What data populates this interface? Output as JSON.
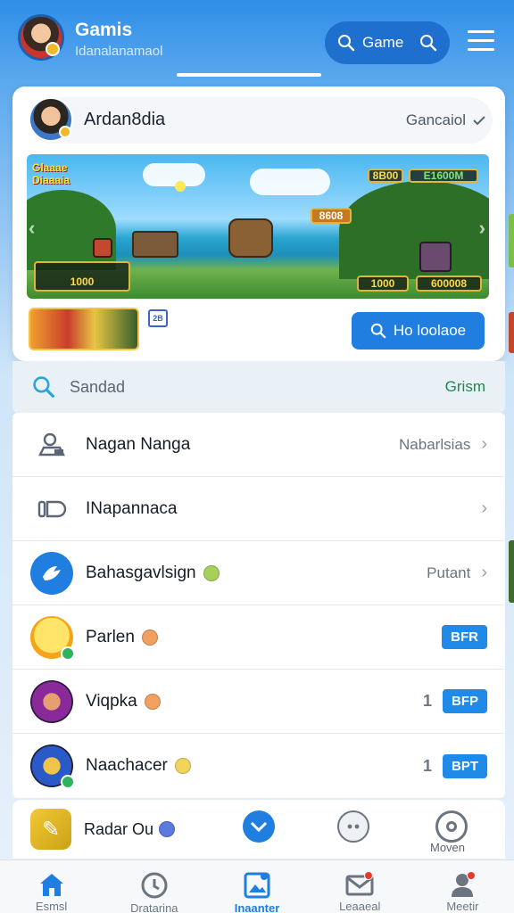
{
  "header": {
    "title": "Gamis",
    "subtitle": "Idanalanamaol",
    "search_label": "Game"
  },
  "profile": {
    "name": "Ardan8dia",
    "cancel_label": "Gancaiol"
  },
  "banner": {
    "top_left_text": "Glaaae\nDiaaaia",
    "top_right_badges": [
      "8B00",
      "E1600M"
    ],
    "stage_badge": "8608",
    "bottom_left_text": "1000",
    "bottom_right_badges": [
      "1000",
      "600008"
    ],
    "thumb_badge": "2B"
  },
  "cta": {
    "label": "Ho loolaoe"
  },
  "searchbar": {
    "placeholder": "Sandad",
    "action": "Grism"
  },
  "list": [
    {
      "name": "Nagan Nanga",
      "right": "Nabarlsias",
      "icon": "user-pin-icon",
      "chevron": true
    },
    {
      "name": "INapannaca",
      "right": "",
      "icon": "tag-icon",
      "chevron": true
    },
    {
      "name": "Bahasgavlsign",
      "right": "Putant",
      "icon": "bird-icon",
      "chevron": true
    },
    {
      "name": "Parlen",
      "right": "",
      "icon": "sun-face-icon",
      "tag": "BFR"
    },
    {
      "name": "Viqpka",
      "right": "",
      "icon": "wizard-avatar-icon",
      "num": "1",
      "tag": "BFP"
    },
    {
      "name": "Naachacer",
      "right": "",
      "icon": "armor-avatar-icon",
      "num": "1",
      "tag": "BPT"
    }
  ],
  "dock": {
    "app_name": "Radar Ou",
    "more_label": "Moven"
  },
  "nav": [
    {
      "label": "Esmsl",
      "icon": "home-icon",
      "active": false
    },
    {
      "label": "Dratarina",
      "icon": "clock-icon",
      "active": false
    },
    {
      "label": "Inaanter",
      "icon": "photo-icon",
      "active": true
    },
    {
      "label": "Leaaeal",
      "icon": "mail-icon",
      "active": false
    },
    {
      "label": "Meetir",
      "icon": "person-icon",
      "active": false
    }
  ],
  "colors": {
    "primary": "#1f7ee0",
    "accent_green": "#1e8a4a"
  }
}
